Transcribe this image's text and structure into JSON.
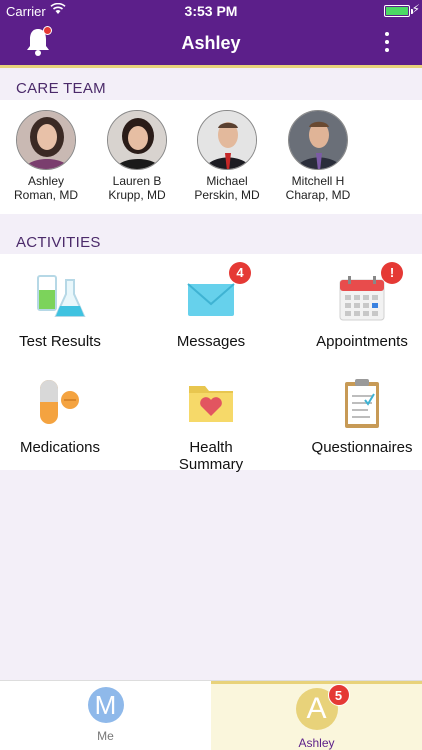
{
  "status": {
    "carrier": "Carrier",
    "time": "3:53 PM"
  },
  "header": {
    "title": "Ashley"
  },
  "care_team": {
    "heading": "CARE TEAM",
    "members": [
      {
        "name_line1": "Ashley",
        "name_line2": "Roman, MD"
      },
      {
        "name_line1": "Lauren B",
        "name_line2": "Krupp, MD"
      },
      {
        "name_line1": "Michael",
        "name_line2": "Perskin, MD"
      },
      {
        "name_line1": "Mitchell H",
        "name_line2": "Charap, MD"
      }
    ]
  },
  "activities": {
    "heading": "ACTIVITIES",
    "items": [
      {
        "label": "Test Results",
        "icon": "lab-flask-icon"
      },
      {
        "label": "Messages",
        "icon": "envelope-icon",
        "badge": "4"
      },
      {
        "label": "Appointments",
        "icon": "calendar-icon",
        "badge": "!"
      },
      {
        "label": "Medications",
        "icon": "pills-icon"
      },
      {
        "label": "Health",
        "label2": "Summary",
        "icon": "folder-heart-icon"
      },
      {
        "label": "Questionnaires",
        "icon": "clipboard-icon"
      }
    ]
  },
  "tabs": [
    {
      "initial": "M",
      "label": "Me",
      "color": "#8fb9ea",
      "label_color": "#777777"
    },
    {
      "initial": "A",
      "label": "Ashley",
      "color": "#e8d27a",
      "label_color": "#5c1f8a",
      "badge": "5",
      "selected": true
    }
  ],
  "colors": {
    "brand": "#5c1f8a",
    "accent": "#e8d27a",
    "badge": "#e53935"
  }
}
